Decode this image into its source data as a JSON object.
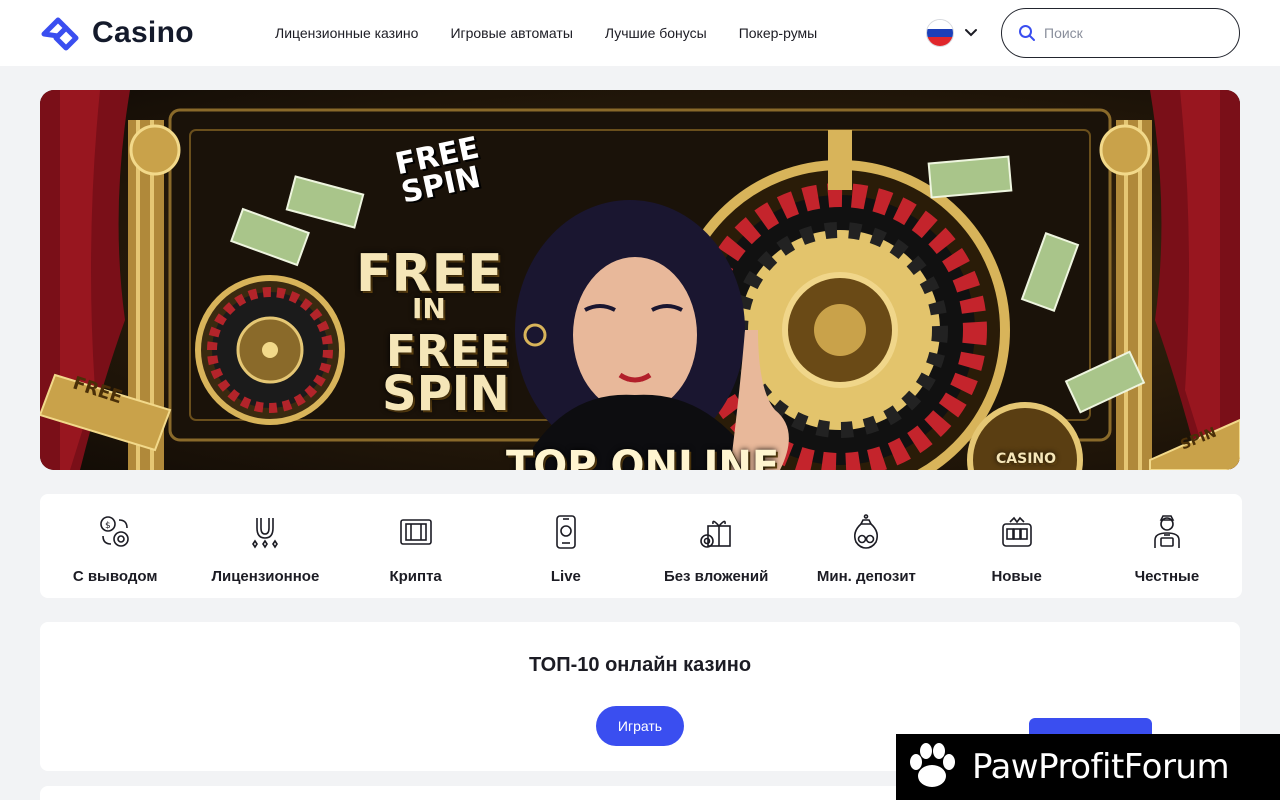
{
  "header": {
    "logo_text": "Casino",
    "nav": [
      {
        "label": "Лицензионные казино"
      },
      {
        "label": "Игровые автоматы"
      },
      {
        "label": "Лучшие бонусы"
      },
      {
        "label": "Покер-румы"
      }
    ],
    "language_flag": "russia-flag",
    "search_placeholder": "Поиск"
  },
  "banner": {
    "text_free_spin_small": "FREE SPIN",
    "text_free": "FREE",
    "text_in": "IN",
    "text_free2": "FREE",
    "text_spin": "SPIN",
    "text_top_online": "TOP ONLINE",
    "text_casino": "CASINO",
    "text_ribbon_left": "FREE",
    "text_ribbon_right": "SPIN"
  },
  "categories": [
    {
      "label": "С выводом",
      "icon": "coins-exchange-icon"
    },
    {
      "label": "Лицензионное",
      "icon": "horseshoe-icon"
    },
    {
      "label": "Крипта",
      "icon": "crypto-wallet-icon"
    },
    {
      "label": "Live",
      "icon": "smartphone-icon"
    },
    {
      "label": "Без вложений",
      "icon": "gift-chip-icon"
    },
    {
      "label": "Мин. депозит",
      "icon": "money-bag-icon"
    },
    {
      "label": "Новые",
      "icon": "slot-machine-icon"
    },
    {
      "label": "Честные",
      "icon": "dealer-icon"
    }
  ],
  "top_section": {
    "title": "ТОП-10 онлайн казино",
    "play_button": "Играть"
  },
  "watermark": {
    "text": "PawProfitForum"
  },
  "colors": {
    "accent": "#3a4ef0",
    "text": "#1c1c24",
    "background": "#f2f3f5"
  }
}
